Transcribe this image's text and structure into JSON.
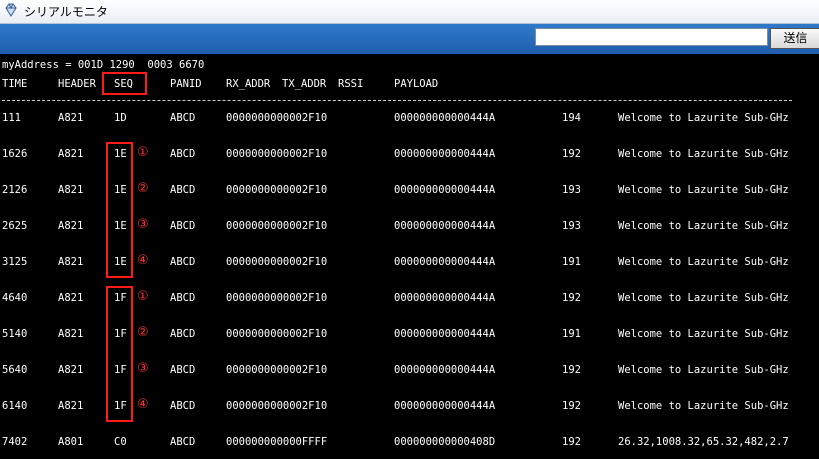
{
  "window": {
    "title": "シリアルモニタ",
    "icon": "gem-icon"
  },
  "toolbar": {
    "send_input_value": "",
    "send_label": "送信"
  },
  "console": {
    "address_line": "myAddress = 001D 1290  0003 6670",
    "headers": {
      "time": "TIME",
      "header": "HEADER",
      "seq": "SEQ",
      "panid": "PANID",
      "rx_addr": "RX_ADDR",
      "tx_addr": "TX_ADDR",
      "rssi": "RSSI",
      "payload": "PAYLOAD"
    },
    "rows": [
      {
        "time": "111",
        "header": "A821",
        "seq": "1D",
        "panid": "ABCD",
        "rx": "0000000000002F10",
        "tx": "000000000000444A",
        "rssi": "194",
        "payload": "Welcome to Lazurite Sub-GHz",
        "mark": ""
      },
      {
        "time": "1626",
        "header": "A821",
        "seq": "1E",
        "panid": "ABCD",
        "rx": "0000000000002F10",
        "tx": "000000000000444A",
        "rssi": "192",
        "payload": "Welcome to Lazurite Sub-GHz",
        "mark": "①"
      },
      {
        "time": "2126",
        "header": "A821",
        "seq": "1E",
        "panid": "ABCD",
        "rx": "0000000000002F10",
        "tx": "000000000000444A",
        "rssi": "193",
        "payload": "Welcome to Lazurite Sub-GHz",
        "mark": "②"
      },
      {
        "time": "2625",
        "header": "A821",
        "seq": "1E",
        "panid": "ABCD",
        "rx": "0000000000002F10",
        "tx": "000000000000444A",
        "rssi": "193",
        "payload": "Welcome to Lazurite Sub-GHz",
        "mark": "③"
      },
      {
        "time": "3125",
        "header": "A821",
        "seq": "1E",
        "panid": "ABCD",
        "rx": "0000000000002F10",
        "tx": "000000000000444A",
        "rssi": "191",
        "payload": "Welcome to Lazurite Sub-GHz",
        "mark": "④"
      },
      {
        "time": "4640",
        "header": "A821",
        "seq": "1F",
        "panid": "ABCD",
        "rx": "0000000000002F10",
        "tx": "000000000000444A",
        "rssi": "192",
        "payload": "Welcome to Lazurite Sub-GHz",
        "mark": "①"
      },
      {
        "time": "5140",
        "header": "A821",
        "seq": "1F",
        "panid": "ABCD",
        "rx": "0000000000002F10",
        "tx": "000000000000444A",
        "rssi": "191",
        "payload": "Welcome to Lazurite Sub-GHz",
        "mark": "②"
      },
      {
        "time": "5640",
        "header": "A821",
        "seq": "1F",
        "panid": "ABCD",
        "rx": "0000000000002F10",
        "tx": "000000000000444A",
        "rssi": "192",
        "payload": "Welcome to Lazurite Sub-GHz",
        "mark": "③"
      },
      {
        "time": "6140",
        "header": "A821",
        "seq": "1F",
        "panid": "ABCD",
        "rx": "0000000000002F10",
        "tx": "000000000000444A",
        "rssi": "192",
        "payload": "Welcome to Lazurite Sub-GHz",
        "mark": "④"
      },
      {
        "time": "7402",
        "header": "A801",
        "seq": "C0",
        "panid": "ABCD",
        "rx": "000000000000FFFF",
        "tx": "000000000000408D",
        "rssi": "192",
        "payload": "26.32,1008.32,65.32,482,2.7",
        "mark": ""
      }
    ]
  },
  "colors": {
    "accent": "#ff1a1a",
    "toolbar": "#2a6fc0",
    "console_bg": "#000000",
    "console_fg": "#ffffff"
  }
}
